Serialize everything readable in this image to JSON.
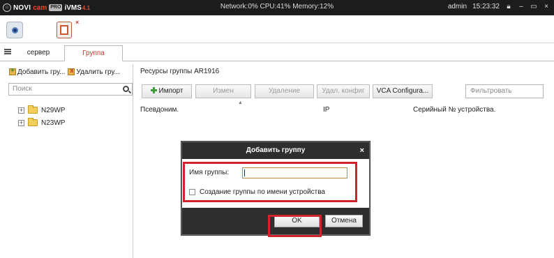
{
  "titlebar": {
    "home_icon": "home-icon",
    "brand": "NOVI",
    "brand_accent": "cam",
    "pro_badge": "PRO",
    "product": "iVMS",
    "version": "4.1",
    "status": "Network:0% CPU:41% Memory:12%",
    "user": "admin",
    "time": "15:23:32",
    "controls": [
      "lock-icon",
      "minimize-icon",
      "maximize-icon",
      "close-icon"
    ]
  },
  "toolbar": {
    "icons": [
      "camera-preview-icon",
      "event-log-icon"
    ]
  },
  "tabs": [
    {
      "label": "сервер",
      "active": false
    },
    {
      "label": "Группа",
      "active": true
    }
  ],
  "left": {
    "add_group": "Добавить гру...",
    "delete_group": "Удалить гру...",
    "search_placeholder": "Поиск",
    "tree": [
      {
        "label": "N29WP"
      },
      {
        "label": "N23WP"
      }
    ]
  },
  "right": {
    "title": "Ресурсы группы AR1916",
    "buttons": {
      "import": "Импорт",
      "edit": "Измен",
      "delete": "Удаление",
      "delete_config": "Удал. конфиг",
      "vca": "VCA Configura..."
    },
    "filter_placeholder": "Фильтровать",
    "columns": {
      "alias": "Псевдоним.",
      "ip": "IP",
      "serial": "Серийный № устройства."
    }
  },
  "dialog": {
    "title": "Добавить группу",
    "name_label": "Имя группы:",
    "name_value": "",
    "checkbox_label": "Создание группы по имени устройства",
    "checkbox_checked": false,
    "ok": "OK",
    "cancel": "Отмена"
  },
  "colors": {
    "titlebar_bg": "#1c1c1c",
    "accent_red": "#c43a2a",
    "highlight": "#d2232a",
    "dialog_header": "#2e2e2e"
  }
}
